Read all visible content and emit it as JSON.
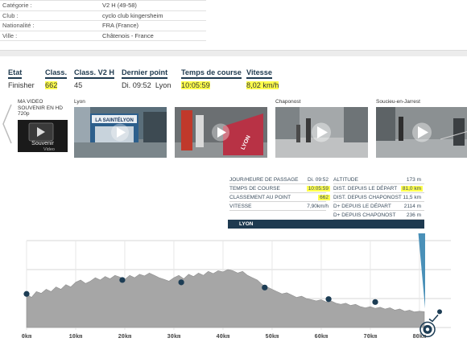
{
  "info": {
    "rows": [
      {
        "label": "Catégorie :",
        "value": "V2 H (49-58)"
      },
      {
        "label": "Club :",
        "value": "cyclo club kingersheim"
      },
      {
        "label": "Nationalité :",
        "value": "FRA (France)"
      },
      {
        "label": "Ville :",
        "value": "Châtenois - France"
      }
    ]
  },
  "status": {
    "etat_label": "Etat",
    "etat_value": "Finisher",
    "class_label": "Class.",
    "class_value": "662",
    "classv2h_label": "Class. V2 H",
    "classv2h_value": "45",
    "dernier_label": "Dernier point",
    "dernier_time": "Di. 09:52",
    "dernier_place": "Lyon",
    "temps_label": "Temps de course",
    "temps_value": "10:05:59",
    "vitesse_label": "Vitesse",
    "vitesse_value": "8,02 km/h"
  },
  "videos": {
    "souvenir_lines": [
      "MA VIDEO",
      "SOUVENIR EN HD",
      "720p"
    ],
    "souvenir_badge_1": "Souvenir",
    "souvenir_badge_2": "Video",
    "thumbs": [
      {
        "label": "Lyon",
        "banner": "LA SAINTÉLYON"
      },
      {
        "label": "",
        "banner": "LYON"
      },
      {
        "label": "Chaponost",
        "banner": ""
      },
      {
        "label": "Soucieu-en-Jarrest",
        "banner": ""
      }
    ]
  },
  "panel": {
    "left": [
      {
        "label": "JOUR/HEURE DE PASSAGE",
        "value": "Di. 09:52",
        "highlight": false
      },
      {
        "label": "TEMPS DE COURSE",
        "value": "10:05:59",
        "highlight": true
      },
      {
        "label": "CLASSEMENT AU POINT",
        "value": "662",
        "highlight": true
      },
      {
        "label": "VITESSE",
        "value": "7,90km/h",
        "highlight": false
      }
    ],
    "right": [
      {
        "label": "ALTITUDE",
        "value": "173 m",
        "highlight": false
      },
      {
        "label": "DIST. DEPUIS LE DÉPART",
        "value": "81,0 km",
        "highlight": true
      },
      {
        "label": "DIST. DEPUIS CHAPONOST",
        "value": "11,5 km",
        "highlight": false
      },
      {
        "label": "D+ DEPUIS LE DÉPART",
        "value": "2114 m",
        "highlight": false
      },
      {
        "label": "D+ DEPUIS CHAPONOST",
        "value": "236 m",
        "highlight": false
      }
    ],
    "point_name": "LYON"
  },
  "chart_data": {
    "type": "area",
    "title": "",
    "xlabel": "",
    "ylabel": "",
    "xlim": [
      0,
      81
    ],
    "ylim": [
      -100,
      1400
    ],
    "x_ticks": [
      "0km",
      "10km",
      "20km",
      "30km",
      "40km",
      "50km",
      "60km",
      "70km",
      "80km"
    ],
    "y_ticks": [
      "-100m",
      "400m",
      "900m",
      "1400m"
    ],
    "grid": true,
    "colors": {
      "fill": "#a6a6a6",
      "marker": "#1d3d55",
      "accent": "#4a90b8"
    },
    "profile": {
      "x": [
        0,
        1,
        2,
        3,
        4,
        5,
        6,
        7,
        8,
        9,
        10,
        11,
        12,
        13,
        14,
        15,
        16,
        17,
        18,
        19,
        20,
        21,
        22,
        23,
        24,
        25,
        26,
        27,
        28,
        29,
        30,
        31,
        32,
        33,
        34,
        35,
        36,
        37,
        38,
        39,
        40,
        41,
        42,
        43,
        44,
        45,
        46,
        47,
        48,
        49,
        50,
        51,
        52,
        53,
        54,
        55,
        56,
        57,
        58,
        59,
        60,
        61,
        62,
        63,
        64,
        65,
        66,
        67,
        68,
        69,
        70,
        71,
        72,
        73,
        74,
        75,
        76,
        77,
        78,
        79,
        80,
        81
      ],
      "y": [
        480,
        420,
        520,
        490,
        560,
        520,
        600,
        560,
        640,
        600,
        680,
        720,
        660,
        700,
        760,
        720,
        780,
        740,
        800,
        770,
        730,
        800,
        760,
        820,
        790,
        840,
        800,
        760,
        730,
        700,
        760,
        800,
        740,
        820,
        780,
        840,
        800,
        870,
        830,
        880,
        860,
        900,
        880,
        840,
        870,
        800,
        760,
        720,
        640,
        600,
        560,
        520,
        480,
        500,
        460,
        420,
        440,
        400,
        380,
        360,
        380,
        340,
        360,
        320,
        300,
        320,
        280,
        300,
        260,
        240,
        260,
        230,
        250,
        220,
        240,
        200,
        220,
        180,
        200,
        170,
        180,
        173
      ]
    },
    "checkpoints": {
      "x": [
        0,
        19.5,
        31.5,
        48.5,
        61.5,
        71.0,
        81.0
      ],
      "y": [
        480,
        720,
        680,
        590,
        390,
        340,
        173
      ]
    }
  }
}
